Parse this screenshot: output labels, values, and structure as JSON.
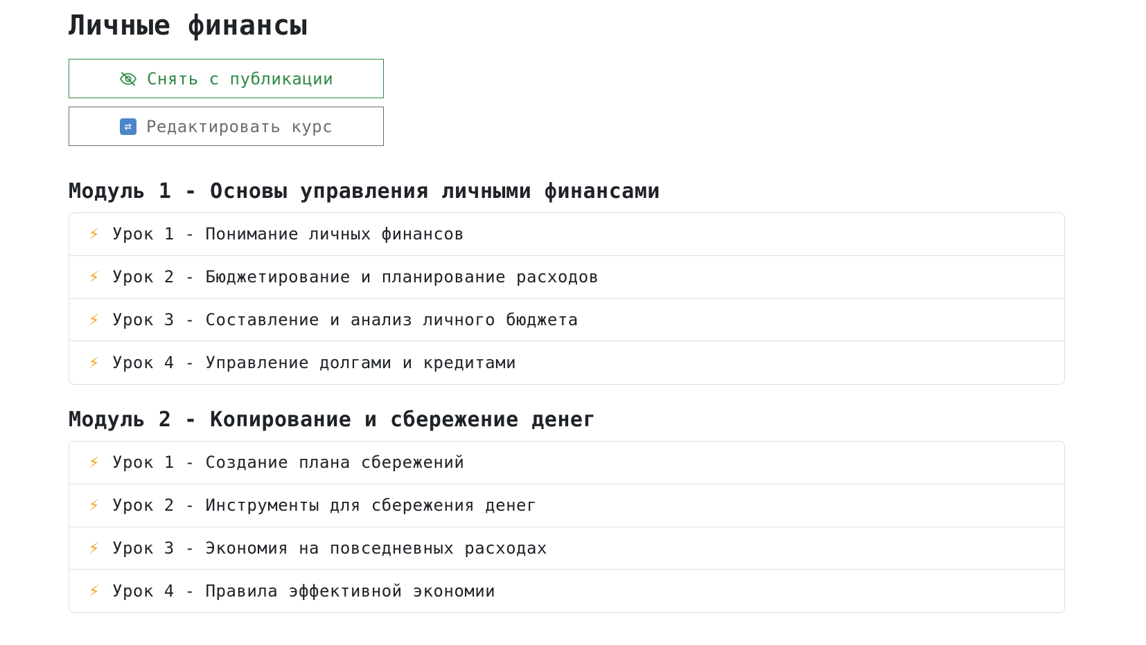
{
  "course": {
    "title": "Личные финансы"
  },
  "actions": {
    "unpublish_label": "Снять с публикации",
    "unpublish_icon": "eye-slash-icon",
    "edit_label": "Редактировать курс",
    "edit_icon": "repeat-icon"
  },
  "colors": {
    "unpublish_accent": "#2f8a46",
    "edit_accent": "#6b6f74",
    "lesson_icon": "#f5a623"
  },
  "modules": [
    {
      "title": "Модуль 1 - Основы управления личными финансами",
      "lessons": [
        {
          "icon": "lightning-icon",
          "label": "Урок 1 - Понимание личных финансов"
        },
        {
          "icon": "lightning-icon",
          "label": "Урок 2 - Бюджетирование и планирование расходов"
        },
        {
          "icon": "lightning-icon",
          "label": "Урок 3 - Составление и анализ личного бюджета"
        },
        {
          "icon": "lightning-icon",
          "label": "Урок 4 - Управление долгами и кредитами"
        }
      ]
    },
    {
      "title": "Модуль 2 - Копирование и сбережение денег",
      "lessons": [
        {
          "icon": "lightning-icon",
          "label": "Урок 1 - Создание плана сбережений"
        },
        {
          "icon": "lightning-icon",
          "label": "Урок 2 - Инструменты для сбережения денег"
        },
        {
          "icon": "lightning-icon",
          "label": "Урок 3 - Экономия на повседневных расходах"
        },
        {
          "icon": "lightning-icon",
          "label": "Урок 4 - Правила эффективной экономии"
        }
      ]
    }
  ]
}
